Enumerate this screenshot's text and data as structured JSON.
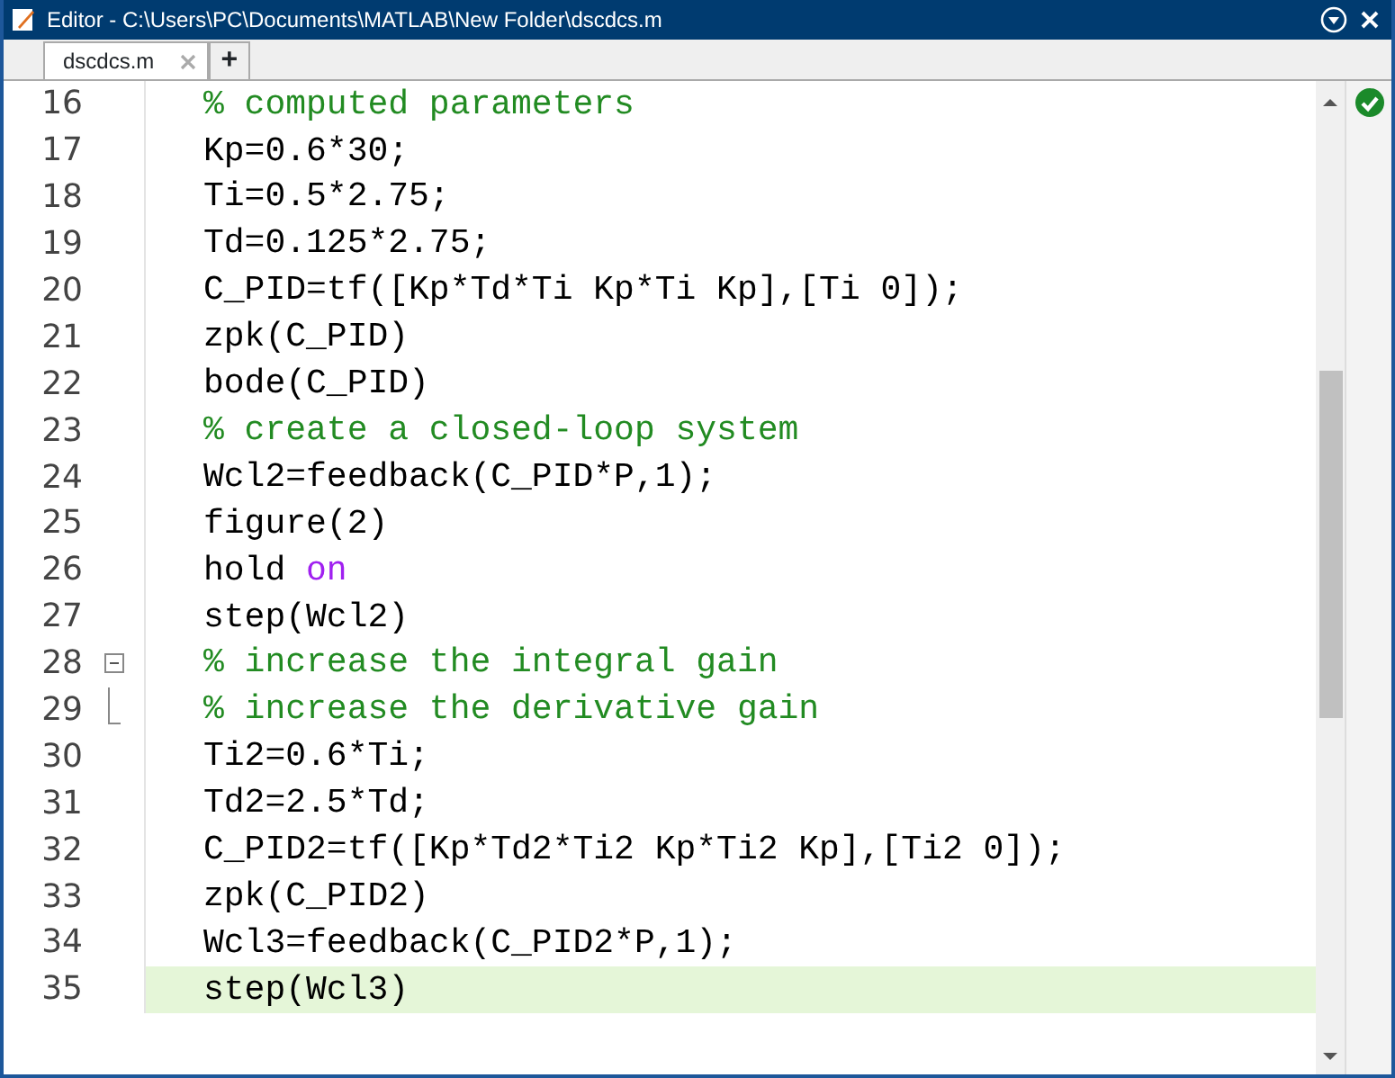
{
  "window": {
    "title": "Editor - C:\\Users\\PC\\Documents\\MATLAB\\New Folder\\dscdcs.m"
  },
  "tabs": [
    {
      "label": "dscdcs.m",
      "selected": true
    },
    {
      "label": "+",
      "selected": false
    }
  ],
  "lines": [
    {
      "number": "16",
      "current": false,
      "tokens": [
        {
          "kind": "comment",
          "text": "% computed parameters"
        }
      ]
    },
    {
      "number": "17",
      "current": false,
      "tokens": [
        {
          "kind": "code",
          "text": "Kp=0.6*30;"
        }
      ]
    },
    {
      "number": "18",
      "current": false,
      "tokens": [
        {
          "kind": "code",
          "text": "Ti=0.5*2.75;"
        }
      ]
    },
    {
      "number": "19",
      "current": false,
      "tokens": [
        {
          "kind": "code",
          "text": "Td=0.125*2.75;"
        }
      ]
    },
    {
      "number": "20",
      "current": false,
      "tokens": [
        {
          "kind": "code",
          "text": "C_PID=tf([Kp*Td*Ti Kp*Ti Kp],[Ti 0]);"
        }
      ]
    },
    {
      "number": "21",
      "current": false,
      "tokens": [
        {
          "kind": "code",
          "text": "zpk(C_PID)"
        }
      ]
    },
    {
      "number": "22",
      "current": false,
      "tokens": [
        {
          "kind": "code",
          "text": "bode(C_PID)"
        }
      ]
    },
    {
      "number": "23",
      "current": false,
      "tokens": [
        {
          "kind": "comment",
          "text": "% create a closed-loop system"
        }
      ]
    },
    {
      "number": "24",
      "current": false,
      "tokens": [
        {
          "kind": "code",
          "text": "Wcl2=feedback(C_PID*P,1);"
        }
      ]
    },
    {
      "number": "25",
      "current": false,
      "tokens": [
        {
          "kind": "code",
          "text": "figure(2)"
        }
      ]
    },
    {
      "number": "26",
      "current": false,
      "tokens": [
        {
          "kind": "code",
          "text": "hold"
        },
        {
          "kind": "keyword",
          "text": "on"
        }
      ]
    },
    {
      "number": "27",
      "current": false,
      "tokens": [
        {
          "kind": "code",
          "text": "step(Wcl2)"
        }
      ]
    },
    {
      "number": "28",
      "current": false,
      "kind": "foldstart",
      "tokens": [
        {
          "kind": "comment",
          "text": "% increase the integral gain"
        }
      ]
    },
    {
      "number": "29",
      "current": false,
      "kind": "foldend",
      "tokens": [
        {
          "kind": "comment",
          "text": "% increase the derivative gain"
        }
      ]
    },
    {
      "number": "30",
      "current": false,
      "tokens": [
        {
          "kind": "code",
          "text": "Ti2=0.6*Ti;"
        }
      ]
    },
    {
      "number": "31",
      "current": false,
      "tokens": [
        {
          "kind": "code",
          "text": "Td2=2.5*Td;"
        }
      ]
    },
    {
      "number": "32",
      "current": false,
      "tokens": [
        {
          "kind": "code",
          "text": "C_PID2=tf([Kp*Td2*Ti2 Kp*Ti2 Kp],[Ti2 0]);"
        }
      ]
    },
    {
      "number": "33",
      "current": false,
      "tokens": [
        {
          "kind": "code",
          "text": "zpk(C_PID2)"
        }
      ]
    },
    {
      "number": "34",
      "current": false,
      "tokens": [
        {
          "kind": "code",
          "text": "Wcl3=feedback(C_PID2*P,1);"
        }
      ]
    },
    {
      "number": "35",
      "current": true,
      "tokens": [
        {
          "kind": "code",
          "text": "step(Wcl3)"
        }
      ]
    }
  ]
}
